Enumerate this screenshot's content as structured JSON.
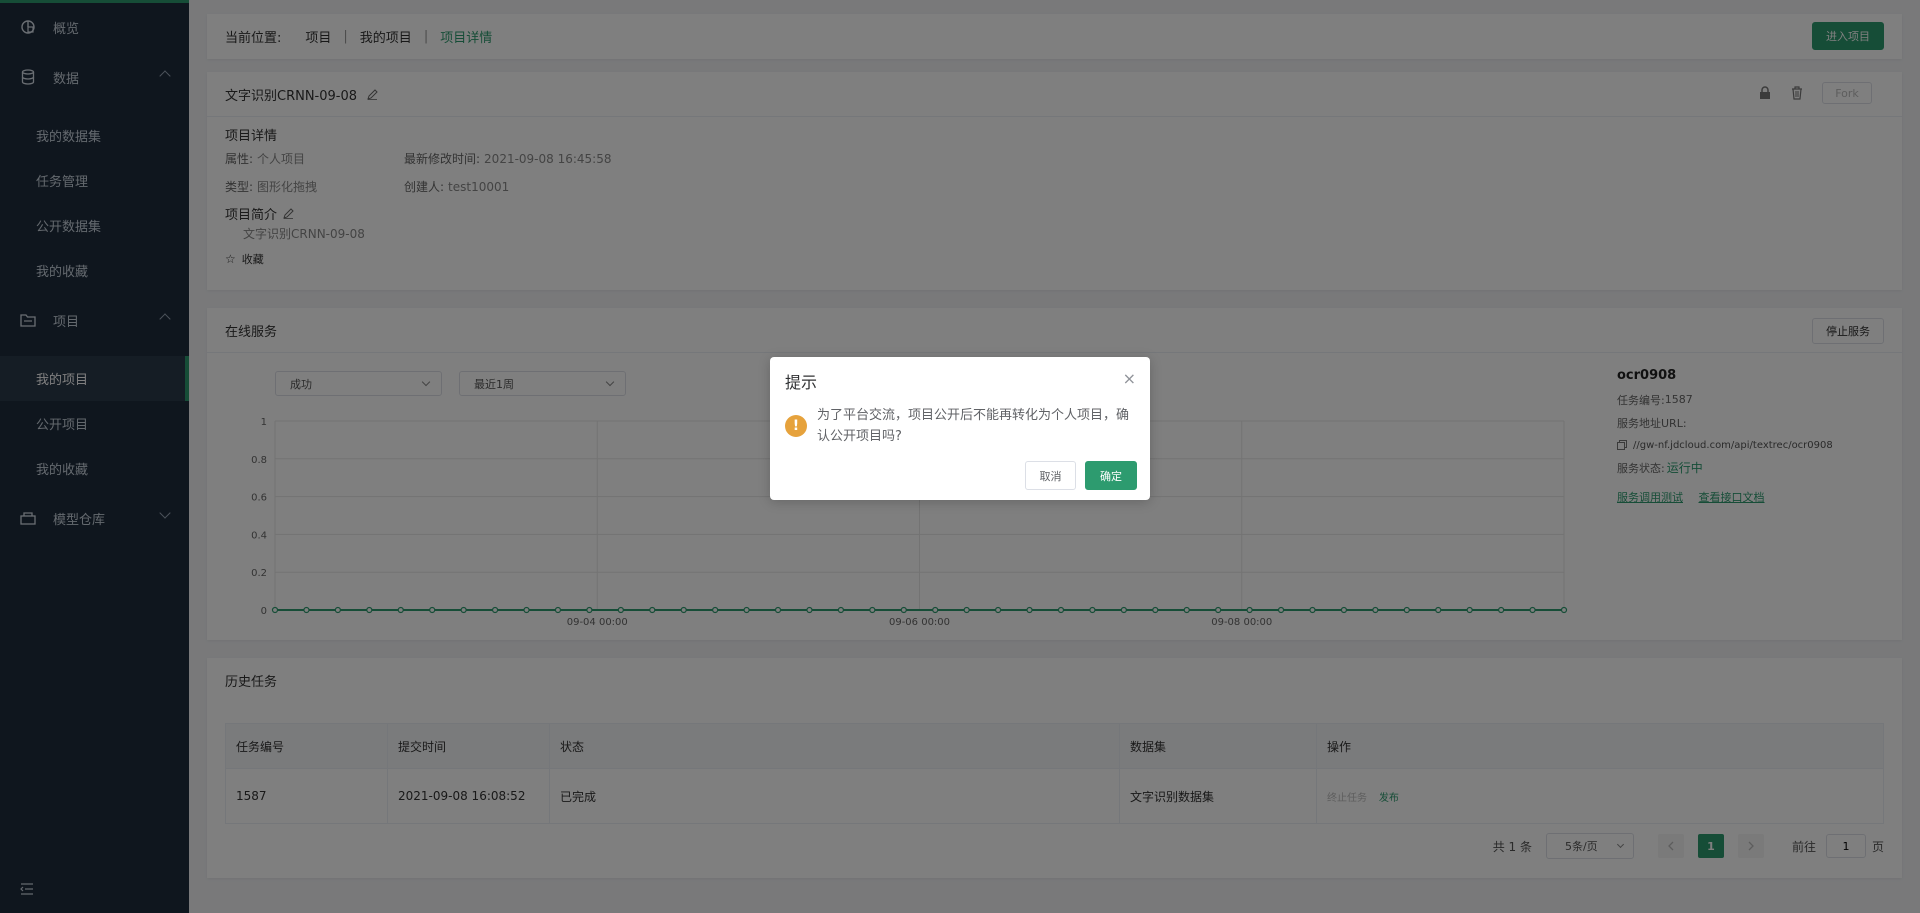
{
  "sidebar": {
    "items": [
      {
        "label": "概览",
        "icon": "dashboard-icon"
      },
      {
        "label": "数据",
        "icon": "database-icon"
      },
      {
        "label": "我的数据集"
      },
      {
        "label": "任务管理"
      },
      {
        "label": "公开数据集"
      },
      {
        "label": "我的收藏"
      },
      {
        "label": "项目",
        "icon": "folder-icon"
      },
      {
        "label": "我的项目"
      },
      {
        "label": "公开项目"
      },
      {
        "label": "我的收藏"
      },
      {
        "label": "模型仓库",
        "icon": "model-icon"
      }
    ]
  },
  "breadcrumb": {
    "prefix": "当前位置:",
    "items": [
      "项目",
      "我的项目",
      "项目详情"
    ],
    "sep": "|",
    "enter_button": "进入项目"
  },
  "project": {
    "title": "文字识别CRNN-09-08",
    "fork_label": "Fork",
    "details_title": "项目详情",
    "attr_key": "属性:",
    "attr_val": "个人项目",
    "modified_key": "最新修改时间:",
    "modified_val": "2021-09-08 16:45:58",
    "type_key": "类型:",
    "type_val": "图形化拖拽",
    "creator_key": "创建人:",
    "creator_val": "test10001",
    "intro_title": "项目简介",
    "intro_text": "文字识别CRNN-09-08",
    "favorite_label": "收藏"
  },
  "online": {
    "title": "在线服务",
    "stop_button": "停止服务",
    "status_filter": "成功",
    "time_filter": "最近1周",
    "service": {
      "name": "ocr0908",
      "task_id_label": "任务编号:",
      "task_id": "1587",
      "url_label": "服务地址URL:",
      "url": "//gw-nf.jdcloud.com/api/textrec/ocr0908",
      "status_label": "服务状态:",
      "status": "运行中",
      "link_test": "服务调用测试",
      "link_doc": "查看接口文档"
    }
  },
  "chart_data": {
    "type": "line",
    "x_tick_labels": [
      "09-04 00:00",
      "09-06 00:00",
      "09-08 00:00"
    ],
    "y_tick_labels": [
      "1",
      "0.8",
      "0.6",
      "0.4",
      "0.2",
      "0"
    ],
    "ylim": [
      0,
      1
    ],
    "point_count": 42,
    "values": [
      0,
      0,
      0,
      0,
      0,
      0,
      0,
      0,
      0,
      0,
      0,
      0,
      0,
      0,
      0,
      0,
      0,
      0,
      0,
      0,
      0,
      0,
      0,
      0,
      0,
      0,
      0,
      0,
      0,
      0,
      0,
      0,
      0,
      0,
      0,
      0,
      0,
      0,
      0,
      0,
      0,
      0
    ],
    "grid": true,
    "color": "#2d9b6f"
  },
  "history": {
    "title": "历史任务",
    "columns": [
      "任务编号",
      "提交时间",
      "状态",
      "数据集",
      "操作"
    ],
    "rows": [
      {
        "id": "1587",
        "time": "2021-09-08 16:08:52",
        "status": "已完成",
        "dataset": "文字识别数据集",
        "op_stop": "终止任务",
        "op_publish": "发布"
      }
    ],
    "pagination": {
      "total": "共 1 条",
      "page_size": "5条/页",
      "current": "1",
      "goto_label": "前往",
      "goto_value": "1",
      "page_unit": "页"
    }
  },
  "dialog": {
    "title": "提示",
    "close": "×",
    "message": "为了平台交流，项目公开后不能再转化为个人项目，确认公开项目吗?",
    "warn_glyph": "!",
    "cancel": "取消",
    "confirm": "确定"
  },
  "colors": {
    "primary": "#2d9b6f",
    "sidebar_bg": "#1f2d3d",
    "warning": "#e6a23c"
  }
}
